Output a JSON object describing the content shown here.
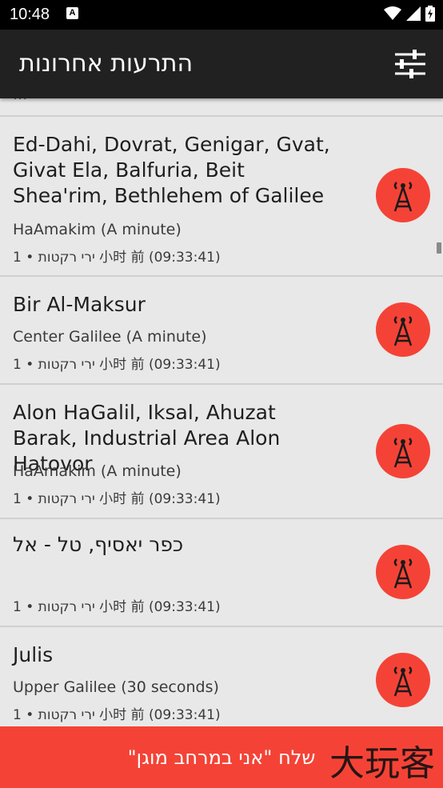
{
  "status_bar": {
    "time": "10:48",
    "notification_glyph": "A",
    "icons": [
      "wifi-icon",
      "signal-icon",
      "battery-charging-icon"
    ]
  },
  "app_bar": {
    "title": "התרעות אחרונות",
    "settings_icon": "tune-sliders-icon"
  },
  "list": {
    "peek_text": "...",
    "items": [
      {
        "title": "Ed-Dahi, Dovrat, Genigar, Gvat, Givat Ela, Balfuria, Beit Shea'rim, Bethlehem of Galilee",
        "subtitle": "HaAmakim (A minute)",
        "meta": "ירי רקטות • 1 小时 前 (09:33:41)"
      },
      {
        "title": "Bir Al-Maksur",
        "subtitle": "Center Galilee (A minute)",
        "meta": "ירי רקטות • 1 小时 前 (09:33:41)"
      },
      {
        "title": "Alon HaGalil, Iksal, Ahuzat Barak, Industrial Area Alon Hatovor",
        "subtitle": "HaAmakim (A minute)",
        "meta": "ירי רקטות • 1 小时 前 (09:33:41)"
      },
      {
        "title": "כפר יאסיף, טל - אל",
        "subtitle": "",
        "meta": "ירי רקטות • 1 小时 前 (09:33:41)"
      },
      {
        "title": "Julis",
        "subtitle": "Upper Galilee (30 seconds)",
        "meta": "ירי רקטות • 1 小时 前 (09:33:41)"
      }
    ]
  },
  "safe_button": {
    "label": "שלח \"אני במרחב מוגן\""
  },
  "watermark": "大玩客",
  "colors": {
    "accent": "#f44336",
    "appbar": "#212121",
    "background": "#e8e8e8"
  }
}
